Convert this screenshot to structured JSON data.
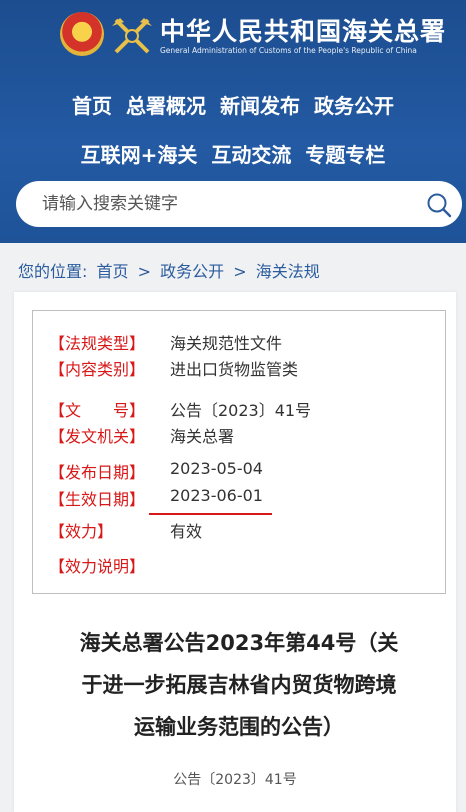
{
  "header": {
    "title": "中华人民共和国海关总署",
    "subtitle": "General Administration of Customs of the People's Republic of China"
  },
  "nav": {
    "row1": [
      "首页",
      "总署概况",
      "新闻发布",
      "政务公开"
    ],
    "row2": [
      "互联网+海关",
      "互动交流",
      "专题专栏"
    ]
  },
  "search": {
    "placeholder": "请输入搜索关键字"
  },
  "breadcrumb": {
    "prefix": "您的位置:",
    "items": [
      "首页",
      "政务公开",
      "海关法规"
    ],
    "separator": ">"
  },
  "meta": [
    {
      "label": "【法规类型】",
      "value": "海关规范性文件"
    },
    {
      "label": "【内容类别】",
      "value": "进出口货物监管类"
    },
    {
      "label": "【文　　号】",
      "value": "公告〔2023〕41号"
    },
    {
      "label": "【发文机关】",
      "value": "海关总署"
    },
    {
      "label": "【发布日期】",
      "value": "2023-05-04"
    },
    {
      "label": "【生效日期】",
      "value": "2023-06-01"
    },
    {
      "label": "【效力】",
      "value": "有效"
    },
    {
      "label": "【效力说明】",
      "value": ""
    }
  ],
  "document": {
    "title_lines": [
      "海关总署公告2023年第44号（关",
      "于进一步拓展吉林省内贸货物跨境",
      "运输业务范围的公告）"
    ],
    "number": "公告〔2023〕41号"
  },
  "colors": {
    "header": "#235aa3",
    "label_red": "#d81818",
    "link_blue": "#2b5c9e"
  }
}
